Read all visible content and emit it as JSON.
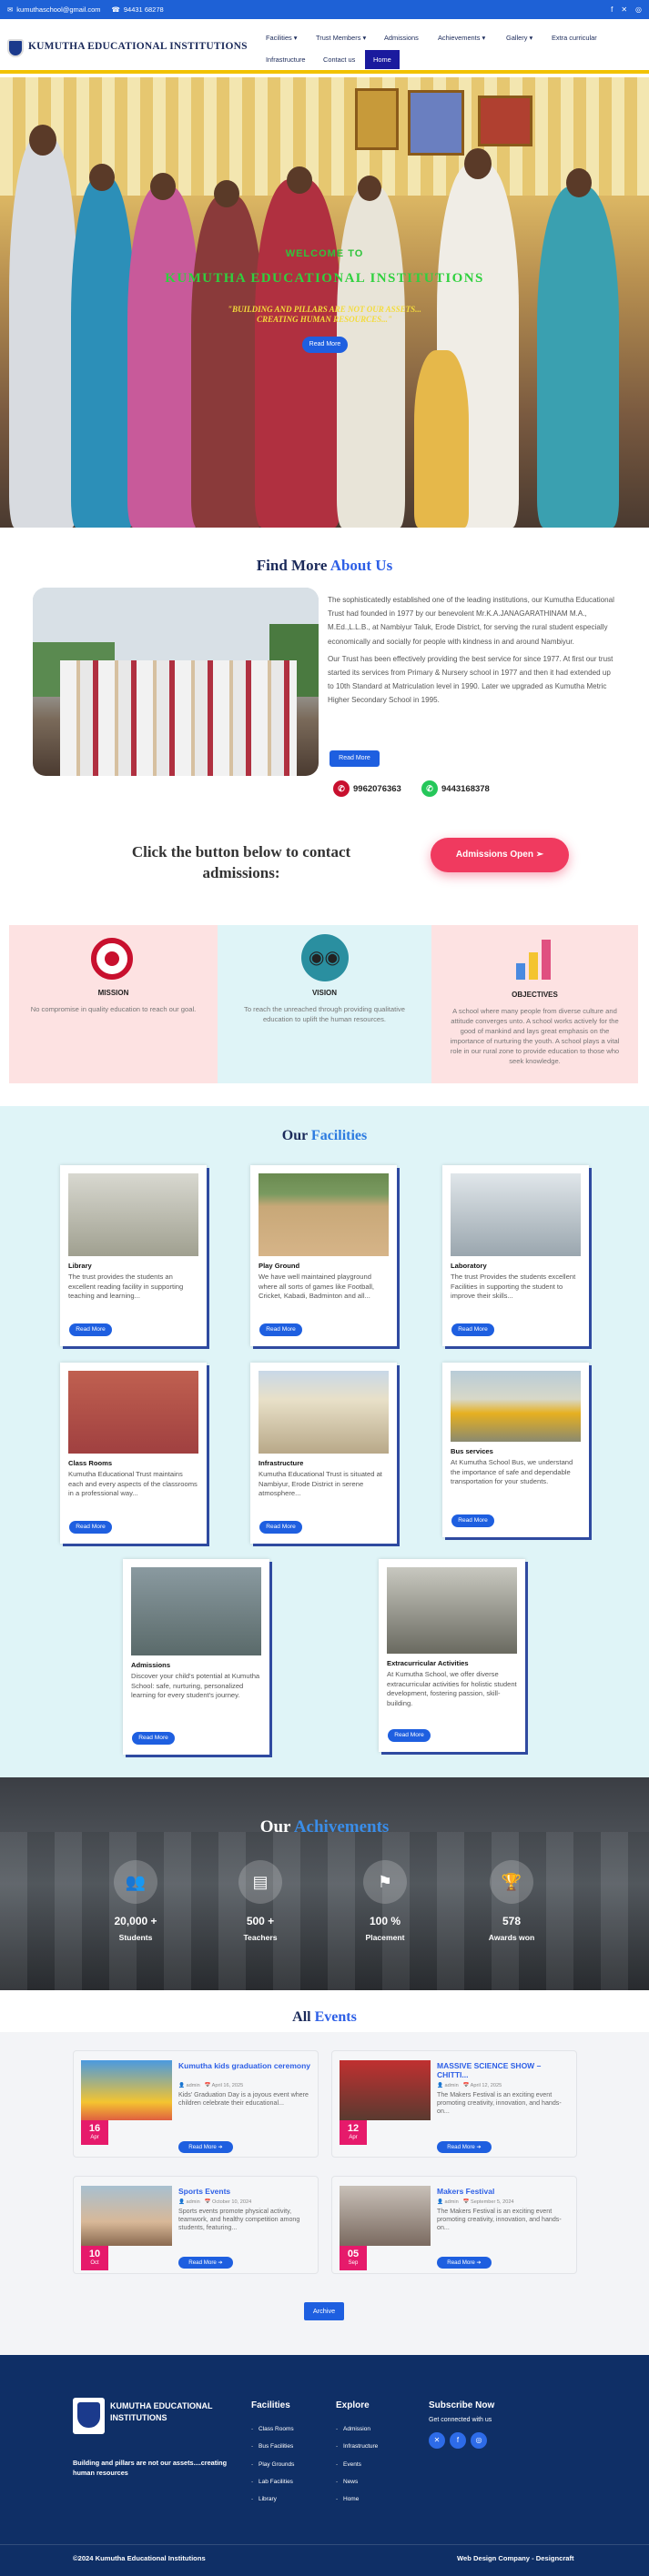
{
  "topbar": {
    "email": "kumuthaschool@gmail.com",
    "phone": "94431 68278"
  },
  "header": {
    "brand": "KUMUTHA EDUCATIONAL INSTITUTIONS"
  },
  "nav": {
    "facilities": "Facilities",
    "trust_members": "Trust Members",
    "admissions": "Admissions",
    "achievements": "Achievements",
    "gallery": "Gallery",
    "extra_curricular": "Extra curricular",
    "infrastructure": "Infrastructure",
    "contact_us": "Contact us",
    "home": "Home"
  },
  "hero": {
    "welcome": "WELCOME TO",
    "title": "KUMUTHA EDUCATIONAL INSTITUTIONS",
    "tag_line1": "\"BUILDING AND PILLARS ARE NOT OUR ASSETS...",
    "tag_line2": "CREATING HUMAN RESOURCES...\"",
    "button": "Read More"
  },
  "about": {
    "title_a": "Find More",
    "title_b": "About Us",
    "p1": "The sophisticatedly established one of the leading institutions, our Kumutha Educational Trust had founded in 1977 by our benevolent Mr.K.A.JANAGARATHINAM M.A., M.Ed.,L.L.B., at Nambiyur Taluk, Erode District, for serving the rural student especially economically  and socially for people with kindness in and around Nambiyur.",
    "p2": "Our Trust has been effectively providing the best service for since 1977. At first our trust started its services from Primary & Nursery school in 1977 and then it had extended up to 10th Standard at Matriculation level in 1990. Later we upgraded as Kumutha Metric Higher Secondary School in 1995.",
    "button": "Read More",
    "phone1": "9962076363",
    "phone2": "9443168378"
  },
  "contact": {
    "text": "Click the button below to contact admissions:",
    "button": "Admissions Open ➢"
  },
  "mvo": [
    {
      "title": "MISSION",
      "desc": "No compromise in quality education to reach our goal."
    },
    {
      "title": "VISION",
      "desc": "To reach the unreached through providing qualitative education to uplift the human resources."
    },
    {
      "title": "OBJECTIVES",
      "desc": "A school where many people from diverse culture and attitude converges unto. A school works actively for the good of mankind and lays great emphasis on the importance of nurturing the youth. A school plays a vital role in our rural zone to provide education to those who seek knowledge."
    }
  ],
  "facilities": {
    "title_a": "Our",
    "title_b": "Facilities",
    "items": [
      {
        "title": "Library",
        "desc": "The trust provides the students an excellent reading facility in supporting teaching and learning...",
        "btn": "Read More"
      },
      {
        "title": "Play Ground",
        "desc": "We have well maintained playground where all sorts of games like Football, Cricket, Kabadi, Badminton and all...",
        "btn": "Read More"
      },
      {
        "title": "Laboratory",
        "desc": "The trust Provides the students excellent Facilities in supporting the student to improve their skills...",
        "btn": "Read More"
      },
      {
        "title": "Class Rooms",
        "desc": "Kumutha Educational Trust maintains each and every aspects of the classrooms in a professional way...",
        "btn": "Read More"
      },
      {
        "title": "Infrastructure",
        "desc": "Kumutha Educational Trust is situated at Nambiyur, Erode District in serene atmosphere...",
        "btn": "Read More"
      },
      {
        "title": "Bus services",
        "desc": "At Kumutha School Bus, we understand the importance of safe and dependable transportation for your students.",
        "btn": "Read More"
      },
      {
        "title": "Admissions",
        "desc": "Discover your child's potential at Kumutha School: safe, nurturing, personalized learning for every student's journey.",
        "btn": "Read More"
      },
      {
        "title": "Extracurricular Activities",
        "desc": "At Kumutha School, we offer diverse extracurricular activities for holistic student development, fostering passion, skill-building.",
        "btn": "Read More"
      }
    ]
  },
  "achievements": {
    "title_a": "Our",
    "title_b": "Achivements",
    "stats": [
      {
        "num": "20,000 +",
        "label": "Students"
      },
      {
        "num": "500 +",
        "label": "Teachers"
      },
      {
        "num": "100 %",
        "label": "Placement"
      },
      {
        "num": "578",
        "label": "Awards won"
      }
    ]
  },
  "events": {
    "title_a": "All",
    "title_b": "Events",
    "items": [
      {
        "title": "Kumutha kids graduation ceremony",
        "author": "admin",
        "date": "April 16, 2025",
        "desc": "Kids' Graduation Day is a joyous event where children celebrate their educational...",
        "day": "16",
        "month": "Apr",
        "btn": "Read More ➔"
      },
      {
        "title": "MASSIVE SCIENCE SHOW – CHITTI...",
        "author": "admin",
        "date": "April 12, 2025",
        "desc": "The Makers Festival is an exciting event promoting creativity, innovation, and hands-on...",
        "day": "12",
        "month": "Apr",
        "btn": "Read More ➔"
      },
      {
        "title": "Sports Events",
        "author": "admin",
        "date": "October 10, 2024",
        "desc": "Sports events promote physical activity, teamwork, and healthy competition among students, featuring...",
        "day": "10",
        "month": "Oct",
        "btn": "Read More ➔"
      },
      {
        "title": "Makers Festival",
        "author": "admin",
        "date": "September 5, 2024",
        "desc": "The Makers Festival is an exciting event promoting creativity, innovation, and hands-on...",
        "day": "05",
        "month": "Sep",
        "btn": "Read More ➔"
      }
    ],
    "archive": "Archive"
  },
  "footer": {
    "brand": "KUMUTHA EDUCATIONAL INSTITUTIONS",
    "tagline": "Building and pillars are not our assets....creating human resources",
    "facilities_head": "Facilities",
    "facilities": [
      "Class Rooms",
      "Bus Facilities",
      "Play Grounds",
      "Lab Facilities",
      "Library"
    ],
    "explore_head": "Explore",
    "explore": [
      "Admission",
      "Infrastructure",
      "Events",
      "News",
      "Home"
    ],
    "subscribe_head": "Subscribe Now",
    "subscribe_text": "Get connected with us",
    "copyright": "©2024 Kumutha Educational Institutions",
    "credit": "Web Design Company - Designcraft"
  }
}
